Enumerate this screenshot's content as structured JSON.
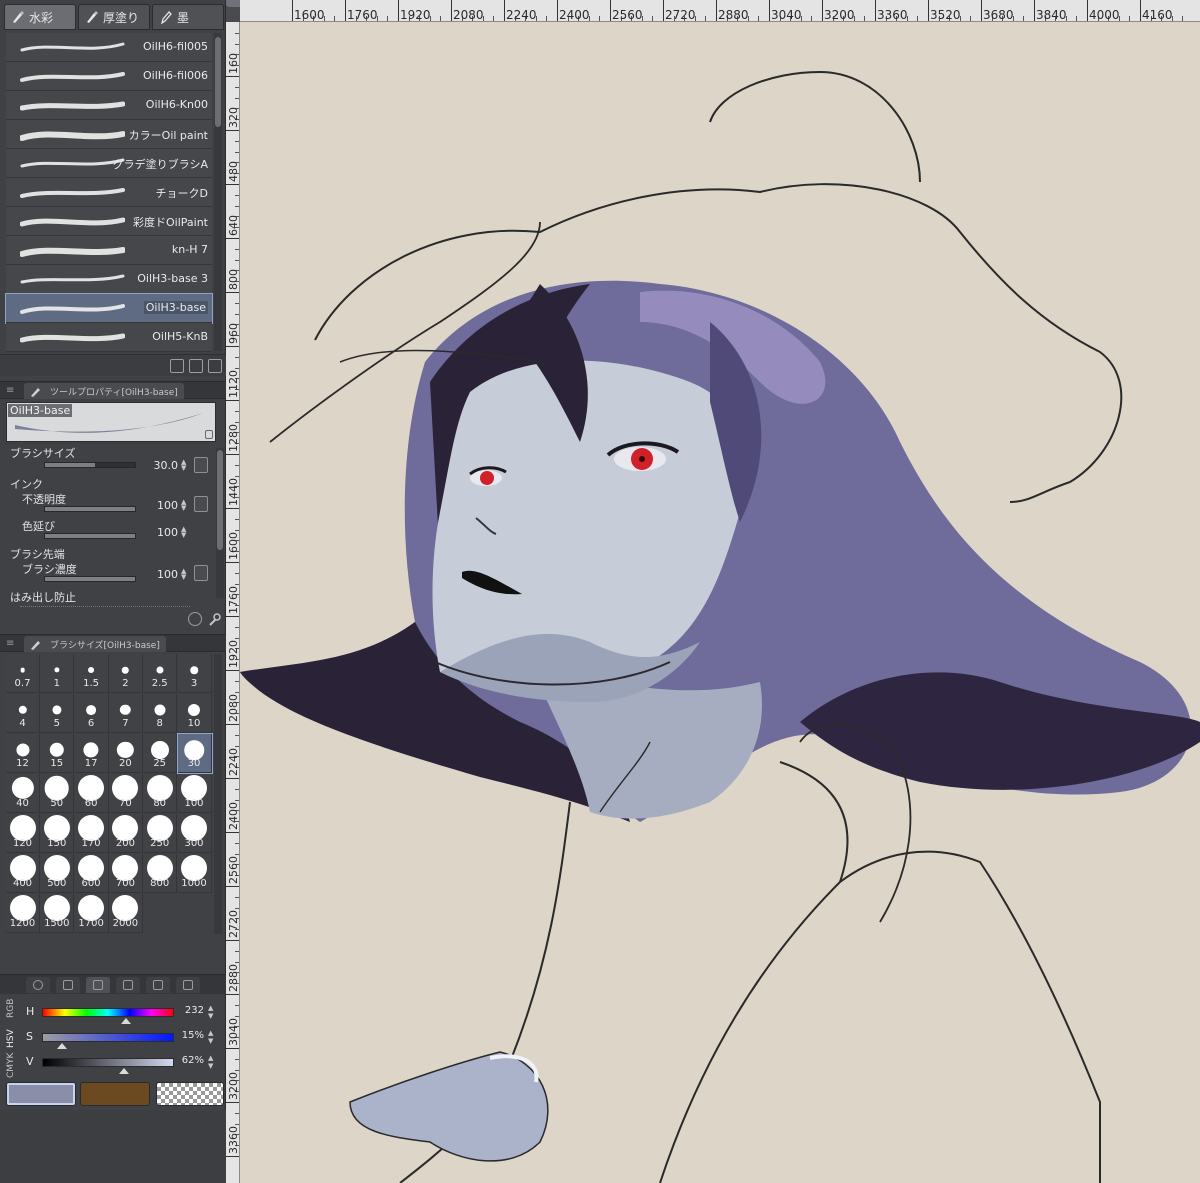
{
  "sub_tool_tabs": [
    {
      "label": "水彩",
      "icon": "brush-icon"
    },
    {
      "label": "厚塗り",
      "icon": "brush-icon"
    },
    {
      "label": "墨",
      "icon": "ink-pen-icon"
    }
  ],
  "brushes": [
    {
      "name": "OilH6-fil005"
    },
    {
      "name": "OilH6-fil006"
    },
    {
      "name": "OilH6-Kn00"
    },
    {
      "name": "カラーOil paint"
    },
    {
      "name": "グラデ塗りブラシA"
    },
    {
      "name": "チョークD"
    },
    {
      "name": "彩度ドOilPaint"
    },
    {
      "name": "kn-H 7"
    },
    {
      "name": "OilH3-base 3"
    },
    {
      "name": "OilH3-base",
      "selected": true
    },
    {
      "name": "OilH5-KnB"
    }
  ],
  "tool_property": {
    "header": "ツールプロパティ[OilH3-base]",
    "preview_label": "OilH3-base",
    "brush_size_label": "ブラシサイズ",
    "brush_size_value": "30.0",
    "ink_label": "インク",
    "opacity_label": "不透明度",
    "opacity_value": "100",
    "color_stretch_label": "色延び",
    "color_stretch_value": "100",
    "brush_tip_label": "ブラシ先端",
    "brush_density_label": "ブラシ濃度",
    "brush_density_value": "100",
    "overflow_label": "はみ出し防止"
  },
  "brush_size_panel": {
    "header": "ブラシサイズ[OilH3-base]",
    "sizes": [
      "0.7",
      "1",
      "1.5",
      "2",
      "2.5",
      "3",
      "4",
      "5",
      "6",
      "7",
      "8",
      "10",
      "12",
      "15",
      "17",
      "20",
      "25",
      "30",
      "40",
      "50",
      "60",
      "70",
      "80",
      "100",
      "120",
      "150",
      "170",
      "200",
      "250",
      "300",
      "400",
      "500",
      "600",
      "700",
      "800",
      "1000",
      "1200",
      "1500",
      "1700",
      "2000"
    ],
    "selected": "30"
  },
  "color_panel": {
    "modes": [
      "RGB",
      "HSV",
      "CMYK"
    ],
    "active_mode": "HSV",
    "h_label": "H",
    "h_value": "232",
    "s_label": "S",
    "s_value": "15%",
    "v_label": "V",
    "v_value": "62%",
    "h_level": 0.64,
    "s_level": 0.15,
    "v_level": 0.62,
    "main_color": "#8a8ea8",
    "sub_color": "#6b4a22"
  },
  "rulers": {
    "top": [
      "1600",
      "1760",
      "1920",
      "2080",
      "2240",
      "2400",
      "2560",
      "2720",
      "2880",
      "3040",
      "3200",
      "3360",
      "3520",
      "3680",
      "3840",
      "4000",
      "4160"
    ],
    "left": [
      "160",
      "320",
      "480",
      "640",
      "800",
      "960",
      "1120",
      "1280",
      "1440",
      "1600",
      "1760",
      "1920",
      "2080",
      "2240",
      "2400",
      "2560",
      "2720",
      "2880",
      "3040",
      "3200",
      "3360"
    ]
  },
  "colors": {
    "panel_bg": "#404145",
    "selection": "#5f6b82",
    "canvas_bg": "#dcd5c8",
    "hair": "#6f6b9a",
    "hair_dark": "#2a2236",
    "skin": "#c7cdd8",
    "eye": "#d0202a"
  }
}
